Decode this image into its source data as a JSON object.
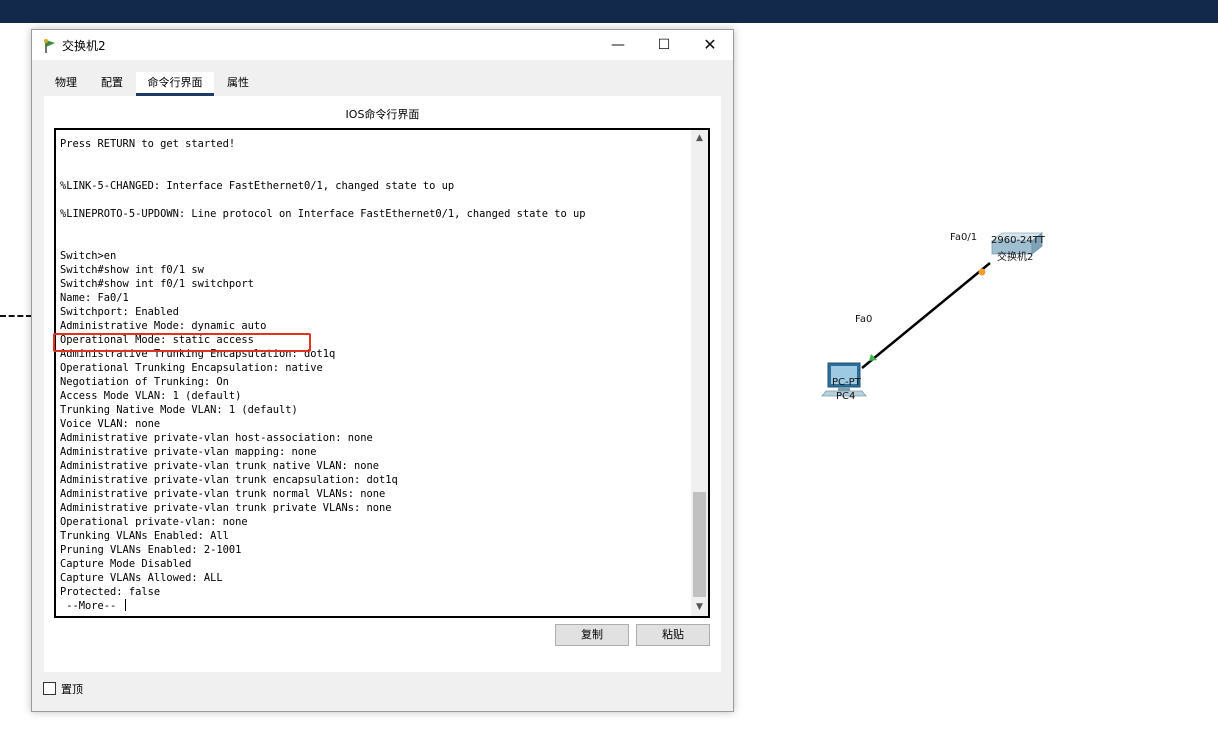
{
  "window": {
    "title": "交换机2",
    "controls": {
      "minimize": "—",
      "maximize": "☐",
      "close": "✕"
    }
  },
  "tabs": [
    {
      "label": "物理",
      "active": false
    },
    {
      "label": "配置",
      "active": false
    },
    {
      "label": "命令行界面",
      "active": true
    },
    {
      "label": "属性",
      "active": false
    }
  ],
  "cli": {
    "title": "IOS命令行界面",
    "lines": [
      "Press RETURN to get started!",
      "",
      "",
      "%LINK-5-CHANGED: Interface FastEthernet0/1, changed state to up",
      "",
      "%LINEPROTO-5-UPDOWN: Line protocol on Interface FastEthernet0/1, changed state to up",
      "",
      "",
      "Switch>en",
      "Switch#show int f0/1 sw",
      "Switch#show int f0/1 switchport",
      "Name: Fa0/1",
      "Switchport: Enabled",
      "Administrative Mode: dynamic auto",
      "Operational Mode: static access",
      "Administrative Trunking Encapsulation: dot1q",
      "Operational Trunking Encapsulation: native",
      "Negotiation of Trunking: On",
      "Access Mode VLAN: 1 (default)",
      "Trunking Native Mode VLAN: 1 (default)",
      "Voice VLAN: none",
      "Administrative private-vlan host-association: none",
      "Administrative private-vlan mapping: none",
      "Administrative private-vlan trunk native VLAN: none",
      "Administrative private-vlan trunk encapsulation: dot1q",
      "Administrative private-vlan trunk normal VLANs: none",
      "Administrative private-vlan trunk private VLANs: none",
      "Operational private-vlan: none",
      "Trunking VLANs Enabled: All",
      "Pruning VLANs Enabled: 2-1001",
      "Capture Mode Disabled",
      "Capture VLANs Allowed: ALL",
      "Protected: false",
      " --More-- "
    ],
    "copy_label": "复制",
    "paste_label": "粘贴"
  },
  "always_on_top": {
    "label": "置顶",
    "checked": false
  },
  "topology": {
    "switch": {
      "model": "2960-24TT",
      "name": "交换机2",
      "port": "Fa0/1"
    },
    "pc": {
      "model": "PC-PT",
      "name": "PC4",
      "port": "Fa0"
    },
    "colors": {
      "link": "#000000",
      "switch_port": "#f0a030",
      "pc_port": "#3cb44b"
    }
  },
  "colors": {
    "topbar": "#13294b",
    "highlight": "#e0341f",
    "active_tab_underline": "#1c3a66"
  }
}
